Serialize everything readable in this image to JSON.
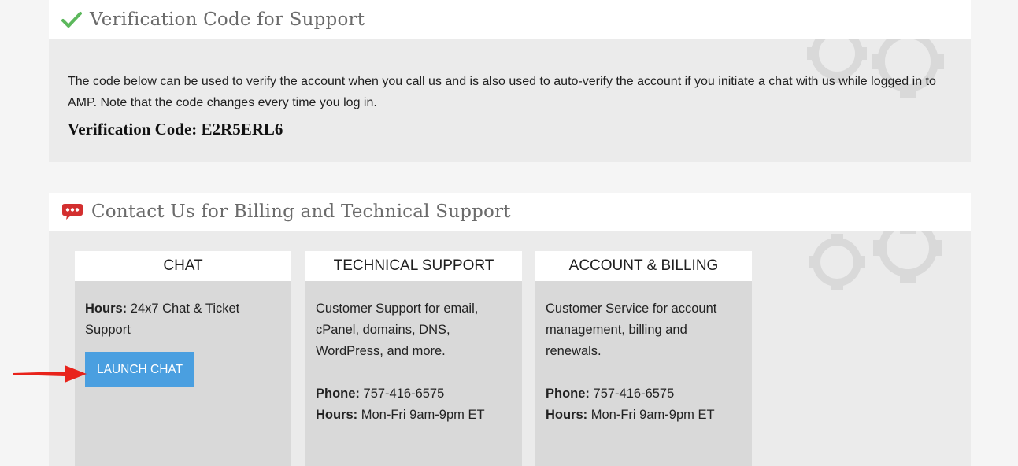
{
  "verification": {
    "title": "Verification Code for Support",
    "description": "The code below can be used to verify the account when you call us and is also used to auto-verify the account if you initiate a chat with us while logged in to AMP. Note that the code changes every time you log in.",
    "code_label": "Verification Code:",
    "code_value": "E2R5ERL6"
  },
  "contact": {
    "title": "Contact Us for Billing and Technical Support",
    "chat": {
      "header": "CHAT",
      "hours_label": "Hours:",
      "hours_value": "24x7 Chat & Ticket Support",
      "button_label": "LAUNCH CHAT"
    },
    "technical": {
      "header": "TECHNICAL SUPPORT",
      "description": "Customer Support for email, cPanel, domains, DNS, WordPress, and more.",
      "phone_label": "Phone:",
      "phone_value": "757-416-6575",
      "hours_label": "Hours:",
      "hours_value": "Mon-Fri 9am-9pm ET"
    },
    "billing": {
      "header": "ACCOUNT & BILLING",
      "description": "Customer Service for account management, billing and renewals.",
      "phone_label": "Phone:",
      "phone_value": "757-416-6575",
      "hours_label": "Hours:",
      "hours_value": "Mon-Fri 9am-9pm ET"
    }
  },
  "icons": {
    "checkmark": "checkmark-icon",
    "chat_bubble": "chat-bubble-icon",
    "gears": "gears-watermark-icon",
    "arrow": "red-arrow-icon"
  },
  "colors": {
    "checkmark": "#4caf50",
    "chat_bubble": "#d32f2f",
    "button": "#4a9fe0",
    "arrow": "#e8231b"
  }
}
